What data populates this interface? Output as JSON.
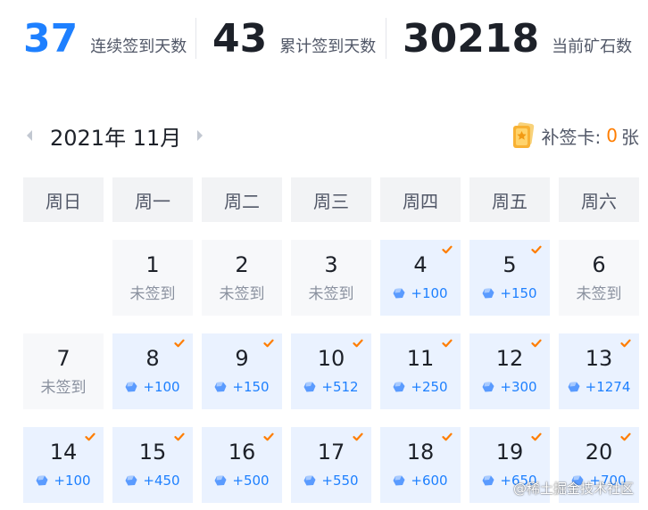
{
  "stats": [
    {
      "value": "37",
      "label": "连续签到天数"
    },
    {
      "value": "43",
      "label": "累计签到天数"
    },
    {
      "value": "30218",
      "label": "当前矿石数"
    }
  ],
  "calendar": {
    "month_label": "2021年 11月",
    "makeup_card": {
      "label": "补签卡:",
      "count": "0",
      "unit": "张",
      "icon": "makeup-card-icon"
    },
    "weekdays": [
      "周日",
      "周一",
      "周二",
      "周三",
      "周四",
      "周五",
      "周六"
    ],
    "unsigned_text": "未签到",
    "days": [
      {
        "day": "1",
        "signed": false
      },
      {
        "day": "2",
        "signed": false
      },
      {
        "day": "3",
        "signed": false
      },
      {
        "day": "4",
        "signed": true,
        "reward": "+100"
      },
      {
        "day": "5",
        "signed": true,
        "reward": "+150"
      },
      {
        "day": "6",
        "signed": false
      },
      {
        "day": "7",
        "signed": false
      },
      {
        "day": "8",
        "signed": true,
        "reward": "+100"
      },
      {
        "day": "9",
        "signed": true,
        "reward": "+150"
      },
      {
        "day": "10",
        "signed": true,
        "reward": "+512"
      },
      {
        "day": "11",
        "signed": true,
        "reward": "+250"
      },
      {
        "day": "12",
        "signed": true,
        "reward": "+300"
      },
      {
        "day": "13",
        "signed": true,
        "reward": "+1274"
      },
      {
        "day": "14",
        "signed": true,
        "reward": "+100"
      },
      {
        "day": "15",
        "signed": true,
        "reward": "+450"
      },
      {
        "day": "16",
        "signed": true,
        "reward": "+500"
      },
      {
        "day": "17",
        "signed": true,
        "reward": "+550"
      },
      {
        "day": "18",
        "signed": true,
        "reward": "+600"
      },
      {
        "day": "19",
        "signed": true,
        "reward": "+650"
      },
      {
        "day": "20",
        "signed": true,
        "reward": "+700"
      }
    ]
  },
  "watermark": "@稀土掘金技术社区",
  "colors": {
    "accent": "#1e80ff",
    "check": "#ff7d00",
    "card": "#f8b133"
  }
}
